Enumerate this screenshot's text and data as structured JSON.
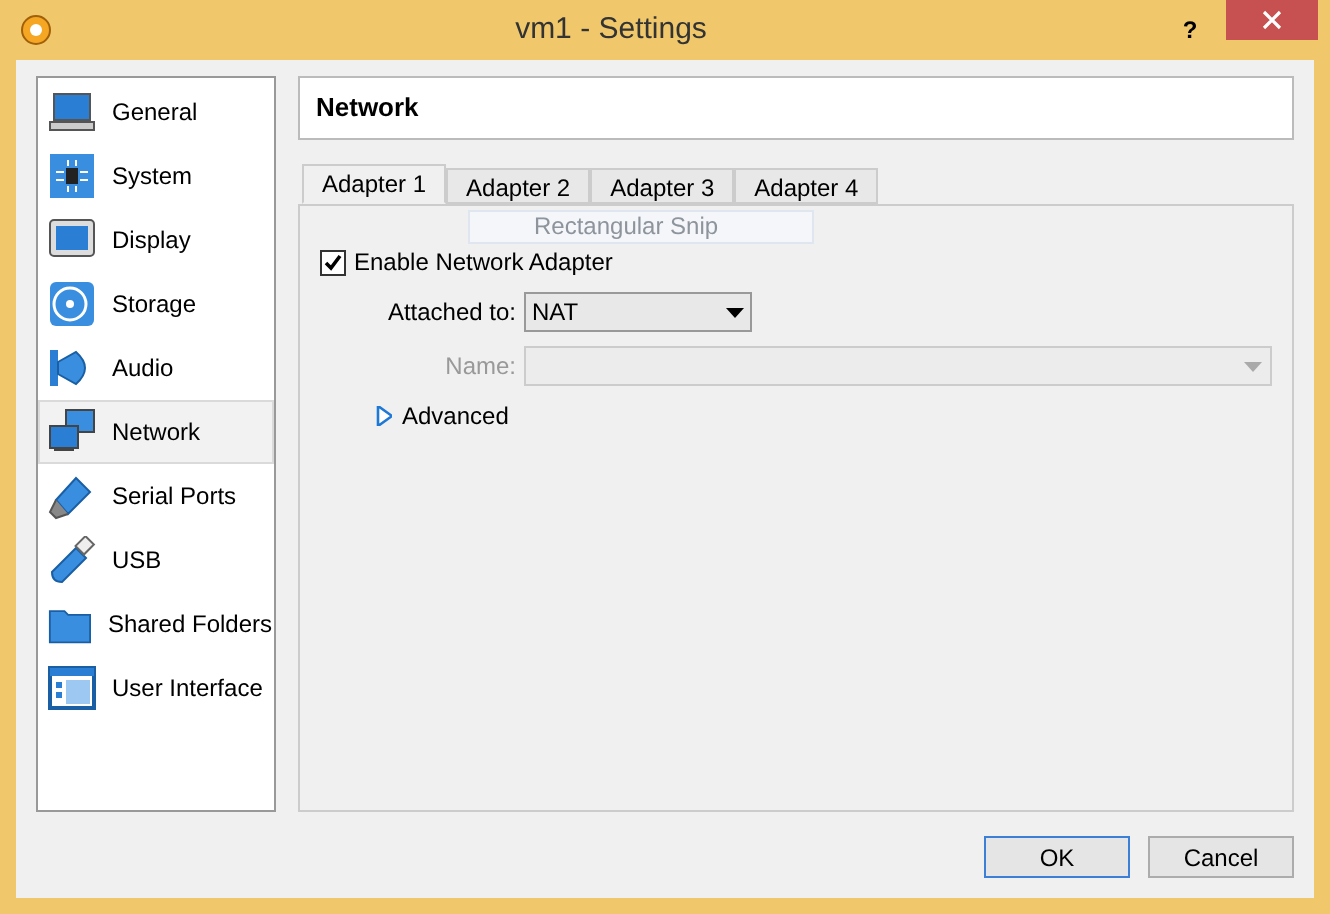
{
  "window": {
    "title": "vm1 - Settings",
    "help": "?"
  },
  "sidebar": {
    "items": [
      {
        "label": "General",
        "kind": "general",
        "selected": false
      },
      {
        "label": "System",
        "kind": "system",
        "selected": false
      },
      {
        "label": "Display",
        "kind": "display",
        "selected": false
      },
      {
        "label": "Storage",
        "kind": "storage",
        "selected": false
      },
      {
        "label": "Audio",
        "kind": "audio",
        "selected": false
      },
      {
        "label": "Network",
        "kind": "network",
        "selected": true
      },
      {
        "label": "Serial Ports",
        "kind": "serial",
        "selected": false
      },
      {
        "label": "USB",
        "kind": "usb",
        "selected": false
      },
      {
        "label": "Shared Folders",
        "kind": "folder",
        "selected": false
      },
      {
        "label": "User Interface",
        "kind": "ui",
        "selected": false
      }
    ]
  },
  "page_title": "Network",
  "tabs": [
    {
      "label": "Adapter 1",
      "selected": true
    },
    {
      "label": "Adapter 2",
      "selected": false
    },
    {
      "label": "Adapter 3",
      "selected": false
    },
    {
      "label": "Adapter 4",
      "selected": false
    }
  ],
  "snip_tooltip": "Rectangular Snip",
  "enable_adapter": {
    "label": "Enable Network Adapter",
    "checked": true
  },
  "attached_to": {
    "label": "Attached to:",
    "value": "NAT"
  },
  "name": {
    "label": "Name:",
    "disabled": true
  },
  "advanced": {
    "label": "Advanced",
    "expanded": false
  },
  "buttons": [
    {
      "label": "OK",
      "default": true
    },
    {
      "label": "Cancel",
      "default": false
    }
  ]
}
